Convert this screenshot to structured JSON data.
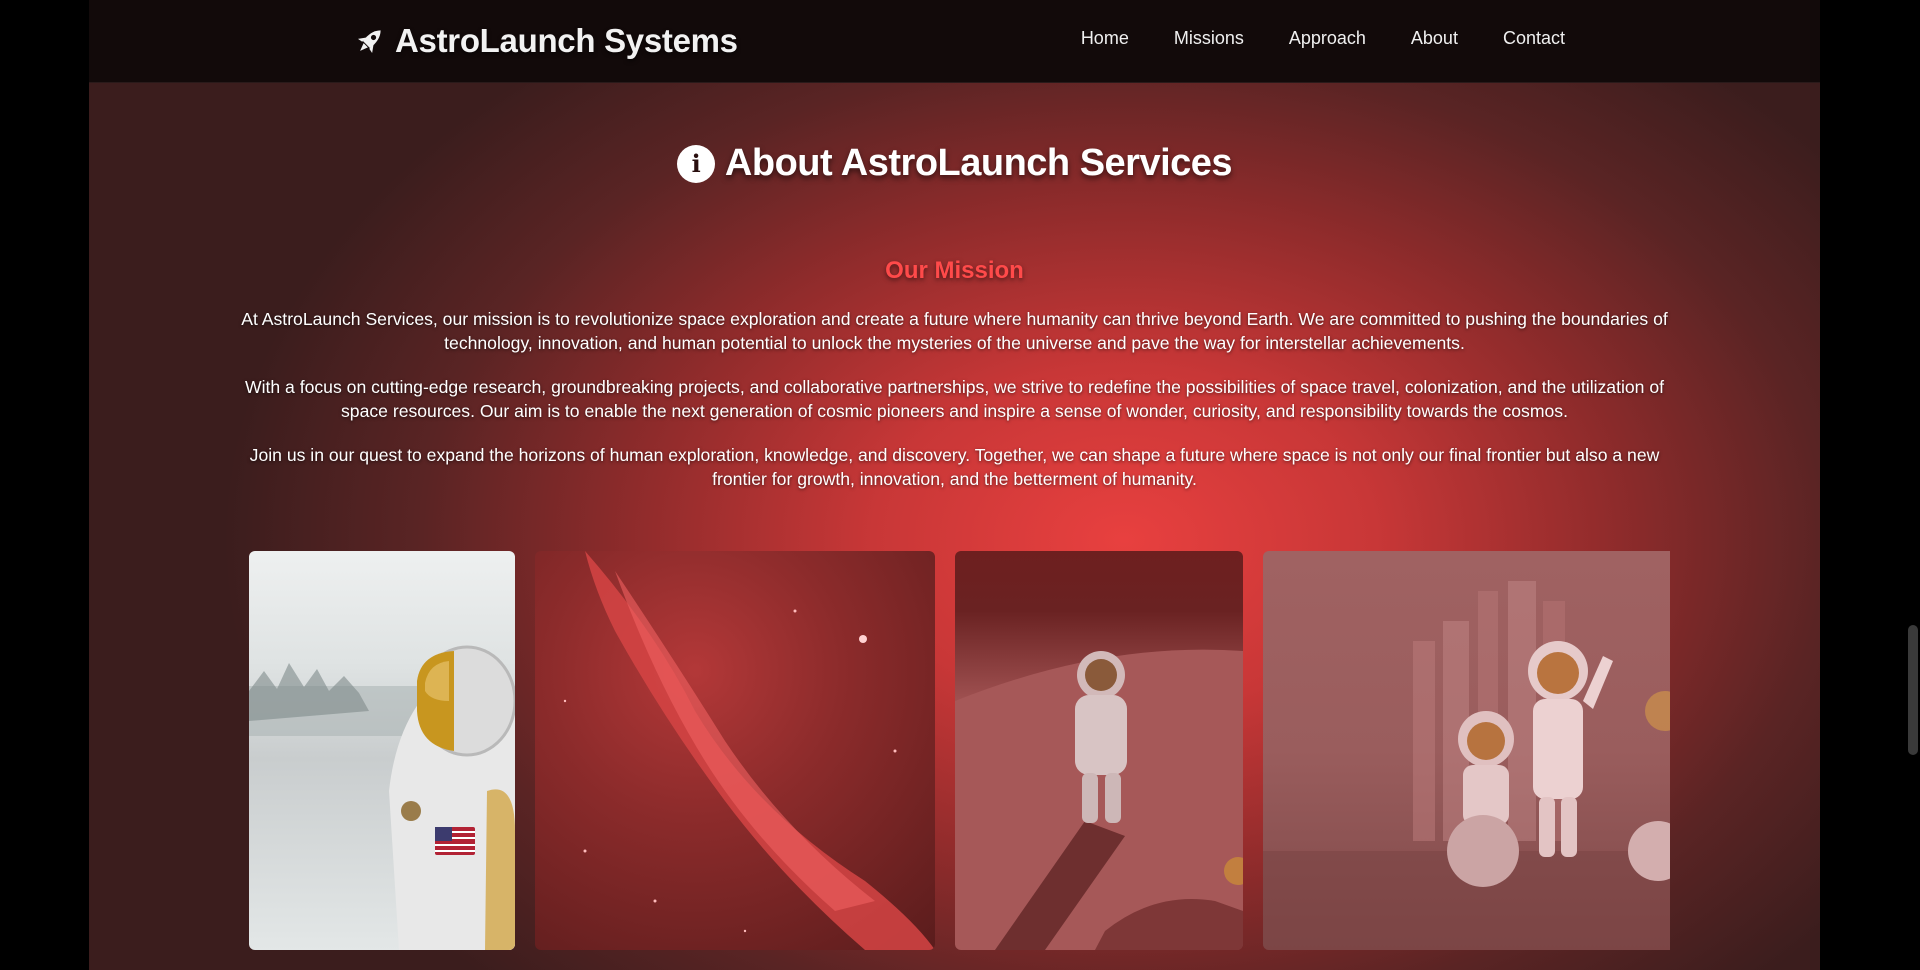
{
  "nav": {
    "brand": "AstroLaunch Systems",
    "links": [
      "Home",
      "Missions",
      "Approach",
      "About",
      "Contact"
    ]
  },
  "about": {
    "heading": "About AstroLaunch Services",
    "mission_title": "Our Mission",
    "paragraphs": [
      "At AstroLaunch Services, our mission is to revolutionize space exploration and create a future where humanity can thrive beyond Earth. We are committed to pushing the boundaries of technology, innovation, and human potential to unlock the mysteries of the universe and pave the way for interstellar achievements.",
      "With a focus on cutting-edge research, groundbreaking projects, and collaborative partnerships, we strive to redefine the possibilities of space travel, colonization, and the utilization of space resources. Our aim is to enable the next generation of cosmic pioneers and inspire a sense of wonder, curiosity, and responsibility towards the cosmos.",
      "Join us in our quest to expand the horizons of human exploration, knowledge, and discovery. Together, we can shape a future where space is not only our final frontier but also a new frontier for growth, innovation, and the betterment of humanity."
    ]
  },
  "colors": {
    "accent": "#ff4a4a",
    "navbar": "#120a0a",
    "background_center": "#e8403f"
  },
  "icons": {
    "brand": "rocket-icon",
    "heading": "info-circle-icon"
  }
}
